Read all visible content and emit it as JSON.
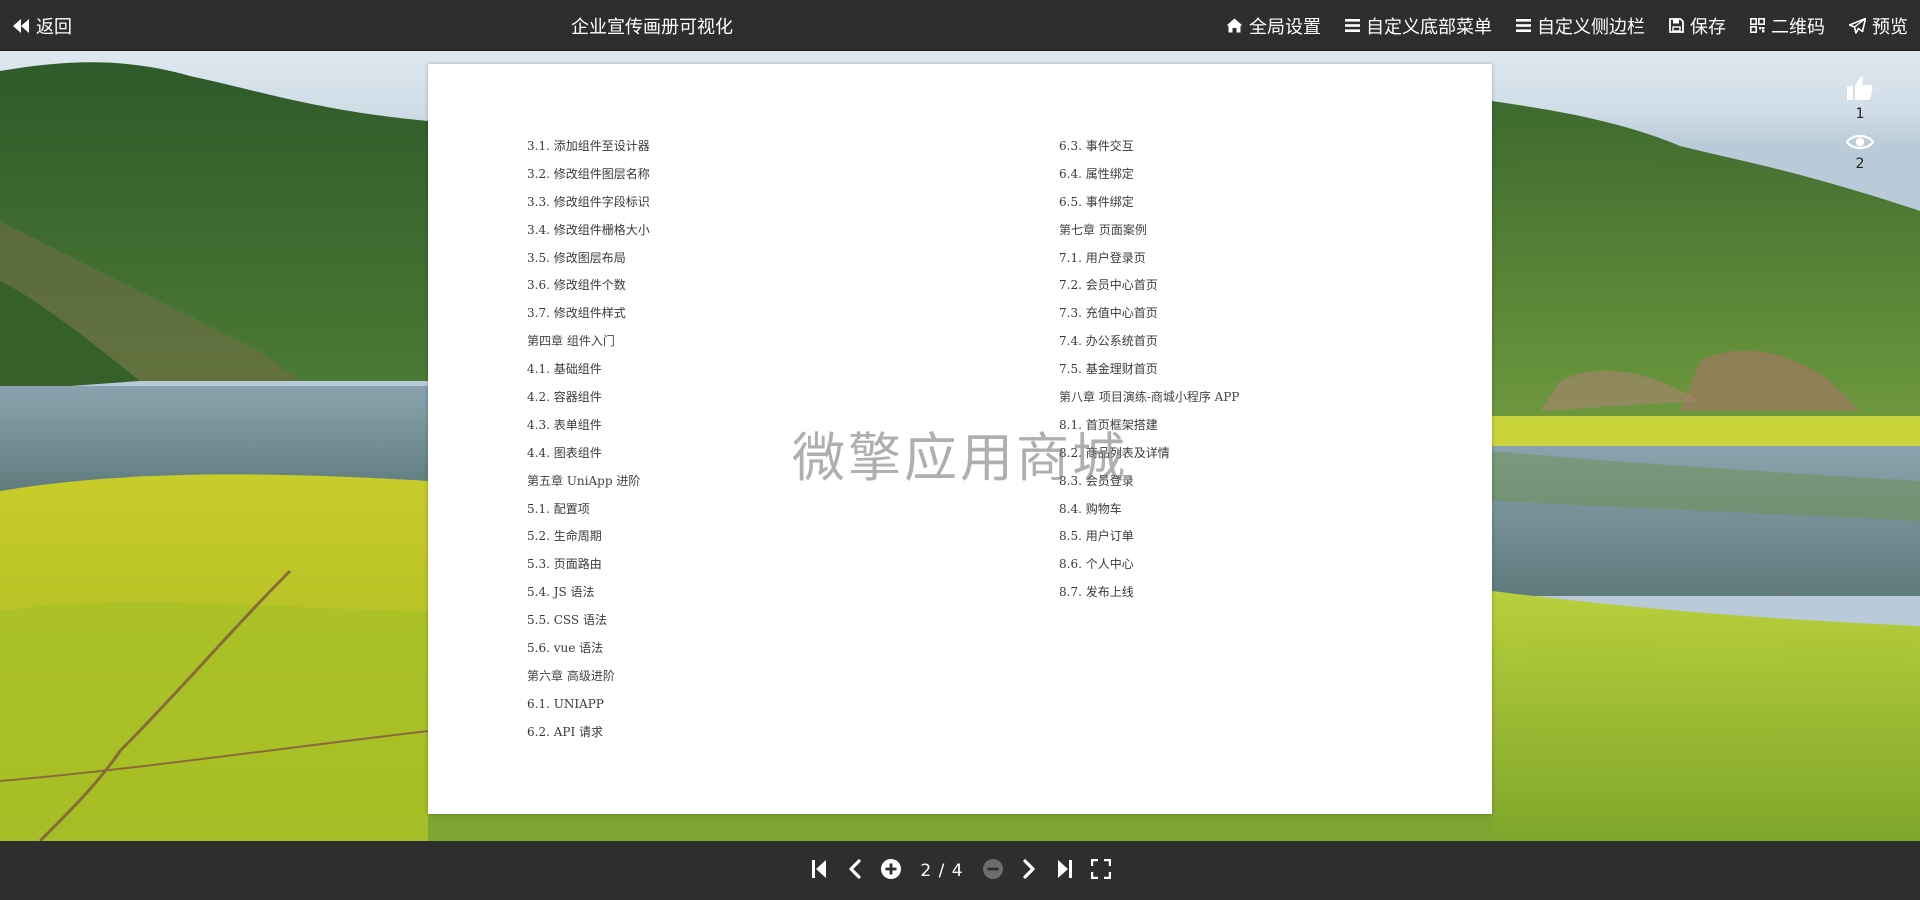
{
  "header": {
    "back_label": "返回",
    "title": "企业宣传画册可视化",
    "actions": [
      {
        "label": "全局设置",
        "icon": "home-icon"
      },
      {
        "label": "自定义底部菜单",
        "icon": "list-icon"
      },
      {
        "label": "自定义侧边栏",
        "icon": "list-icon"
      },
      {
        "label": "保存",
        "icon": "save-icon"
      },
      {
        "label": "二维码",
        "icon": "qrcode-icon"
      },
      {
        "label": "预览",
        "icon": "paper-plane-icon"
      }
    ]
  },
  "document": {
    "left_column": [
      "3.1. 添加组件至设计器",
      "3.2. 修改组件图层名称",
      "3.3. 修改组件字段标识",
      "3.4. 修改组件栅格大小",
      "3.5. 修改图层布局",
      "3.6. 修改组件个数",
      "3.7. 修改组件样式",
      "第四章  组件入门",
      "4.1. 基础组件",
      "4.2. 容器组件",
      "4.3. 表单组件",
      "4.4. 图表组件",
      "第五章  UniApp 进阶",
      "5.1. 配置项",
      "5.2. 生命周期",
      "5.3. 页面路由",
      "5.4. JS 语法",
      "5.5. CSS 语法",
      "5.6. vue 语法",
      "第六章  高级进阶",
      "6.1. UNIAPP",
      "6.2. API 请求"
    ],
    "right_column": [
      "6.3. 事件交互",
      "6.4. 属性绑定",
      "6.5. 事件绑定",
      "第七章  页面案例",
      "7.1. 用户登录页",
      "7.2. 会员中心首页",
      "7.3. 充值中心首页",
      "7.4. 办公系统首页",
      "7.5. 基金理财首页",
      "第八章  项目演练-商城小程序 APP",
      "8.1. 首页框架搭建",
      "8.2. 商品列表及详情",
      "8.3. 会员登录",
      "8.4. 购物车",
      "8.5. 用户订单",
      "8.6. 个人中心",
      "8.7. 发布上线"
    ],
    "watermark": "微擎应用商城"
  },
  "side_stats": {
    "likes": "1",
    "views": "2"
  },
  "pager": {
    "indicator": "2 / 4"
  },
  "colors": {
    "bar_background": "#2e2e2e",
    "page_background": "#ffffff",
    "text": "#3a3a3a"
  }
}
